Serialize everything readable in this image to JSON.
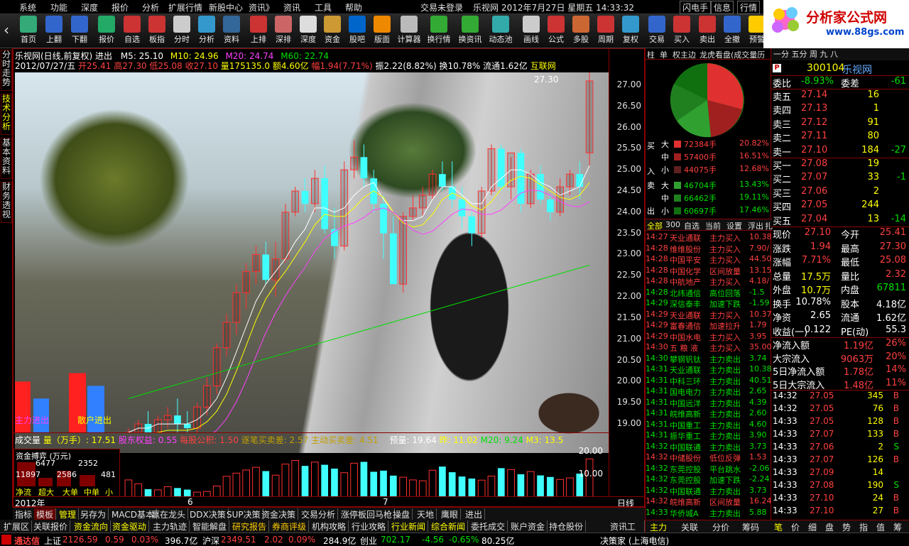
{
  "menu": {
    "items": [
      "系统",
      "功能",
      "深度",
      "报价",
      "分析",
      "扩展行情",
      "新股中心",
      "资讯》",
      "资讯",
      "工具",
      "帮助"
    ],
    "status": "交易未登录",
    "brand": "乐视网",
    "datetime": "2012年7月27日 星期五 14:33:32",
    "right_buttons": [
      "闪电手",
      "信息",
      "行情"
    ]
  },
  "toolbar": {
    "buttons": [
      "首页",
      "上翻",
      "下翻",
      "报价",
      "自选",
      "板指",
      "分时",
      "分析",
      "资料",
      "上排",
      "深排",
      "深度",
      "资金",
      "股吧",
      "版面",
      "计算器",
      "换行情",
      "换资讯",
      "动态池",
      "画线",
      "公式",
      "多股",
      "周期",
      "复权",
      "交易",
      "买入",
      "卖出",
      "全撤",
      "预警"
    ],
    "f6": "F6",
    "f9": "F9",
    "l2": "L2"
  },
  "logo": {
    "title": "分析家公式网",
    "url": "www.88gs.com"
  },
  "sidetabs": [
    "分时走势",
    "技术分析",
    "基本资料",
    "财务透视"
  ],
  "chart": {
    "header": "乐视网(日线,前复权) 进出",
    "ma5": "M5: 25.10",
    "ma10": "M10: 24.96",
    "ma20": "M20: 24.74",
    "ma60": "M60: 22.74",
    "info_date": "2012/07/27/五",
    "open": "开25.41",
    "high": "高27.30",
    "low": "低25.08",
    "close": "收27.10",
    "vol": "量175135.0",
    "amt": "额4.60亿",
    "chg": "幅1.94(7.71%)",
    "amp": "振2.22(8.82%)",
    "turn": "换10.78%",
    "float": "流通1.62亿",
    "sector": "互联网",
    "peak_label": "27.30",
    "sell_label": "散户进出",
    "buy_label": "主力进出",
    "axis": [
      "27.00",
      "26.50",
      "26.00",
      "25.50",
      "25.00",
      "24.50",
      "24.00",
      "23.50",
      "23.00",
      "22.50",
      "22.00",
      "21.50",
      "21.00",
      "20.50",
      "20.00",
      "19.50",
      "19.00"
    ],
    "vol_axis": [
      "20.00",
      "10.00"
    ],
    "vol_info": {
      "label": "成交量",
      "vol": "量（万手）: 17.51",
      "gdqy": "股东权益: 0.55",
      "mggj": "每股公积: 1.50",
      "zbmc": "逐笔买卖差: 2.57",
      "zdmc": "主动买卖差: 4.51",
      "yl": "预量: 19.64",
      "zuo": "昨: 11.02",
      "m20": "M20: 9.24",
      "m3": "M3: 13.5"
    },
    "fund": {
      "title": "资金搏弈 (万元)",
      "v1": "6477",
      "v2": "2352",
      "v3": "11897",
      "v4": "2586",
      "v5": "481",
      "labels": [
        "净流",
        "超大",
        "大单",
        "中单",
        "小单"
      ]
    },
    "year": "2012年",
    "month6": "6",
    "month7": "7",
    "period": "日线"
  },
  "bottom_tabs": [
    "指标",
    "模板",
    "管理",
    "另存为",
    "MACD基本",
    "赢在龙头",
    "DDX决策",
    "SUP决策",
    "资金决策",
    "交易分析",
    "涨停板回马枪",
    "操盘",
    "天地",
    "鹰眼",
    "进出"
  ],
  "bottom_tabs2": [
    "扩展区",
    "关联报价",
    "资金流向",
    "资金驱动",
    "主力轨迹",
    "智能解盘",
    "研究报告",
    "券商评级",
    "机构攻略",
    "行业攻略",
    "行业新闻",
    "综合新闻",
    "委托成交",
    "账户资金",
    "持仓股份",
    "资讯工场"
  ],
  "status": {
    "brand": "通达信",
    "sh_label": "上证",
    "sh": "2126.59",
    "sh_chg": "0.59",
    "sh_pct": "0.03%",
    "sh_amt": "396.7亿",
    "sz_label": "沪深",
    "sz": "2349.51",
    "sz_chg": "2.02",
    "sz_pct": "0.09%",
    "sz_amt": "284.9亿",
    "cy_label": "创业",
    "cy": "702.17",
    "cy_chg": "-4.56",
    "cy_pct": "-0.65%",
    "cy_amt": "80.25亿",
    "right": "决策家 (上海电信)"
  },
  "mid": {
    "tabs": [
      "柱",
      "单",
      "权主边",
      "龙虎看盘(成交量历"
    ],
    "buy": [
      {
        "size": "大",
        "v": "72384手",
        "p": "20.82%"
      },
      {
        "size": "中",
        "v": "57400手",
        "p": "16.51%"
      },
      {
        "size": "小",
        "v": "44075手",
        "p": "12.68%"
      }
    ],
    "sell": [
      {
        "size": "大",
        "v": "46704手",
        "p": "13.43%"
      },
      {
        "size": "中",
        "v": "66462手",
        "p": "19.11%"
      },
      {
        "size": "小",
        "v": "60697手",
        "p": "17.46%"
      }
    ],
    "side_labels": [
      "买",
      "入",
      "卖",
      "出"
    ],
    "filter_tabs": [
      "全部",
      "300",
      "自选",
      "当前",
      "设置",
      "浮出",
      "扎"
    ],
    "tickers": [
      [
        "14:27",
        "天业通联",
        "主力买入",
        "10.38"
      ],
      [
        "14:28",
        "维维股份",
        "主力买入",
        "7.90/"
      ],
      [
        "14:28",
        "中国平安",
        "主力买入",
        "44.50"
      ],
      [
        "14:28",
        "中国化学",
        "区间放量",
        "13.15"
      ],
      [
        "14:28",
        "中航地产",
        "主力买入",
        "4.18/"
      ],
      [
        "14:28",
        "北纬通信",
        "高位回落",
        "-1.5"
      ],
      [
        "14:29",
        "深信泰丰",
        "加速下跌",
        "-1.59"
      ],
      [
        "14:29",
        "天业通联",
        "主力买入",
        "10.37"
      ],
      [
        "14:29",
        "富春通信",
        "加速拉升",
        "1.79"
      ],
      [
        "14:29",
        "中国水电",
        "主力买入",
        "3.95"
      ],
      [
        "14:30",
        "五 粮 液",
        "主力买入",
        "35.00"
      ],
      [
        "14:30",
        "攀钢钒钛",
        "主力卖出",
        "3.74"
      ],
      [
        "14:31",
        "天业通联",
        "主力卖出",
        "10.38"
      ],
      [
        "14:31",
        "中科三环",
        "主力卖出",
        "40.51"
      ],
      [
        "14:31",
        "国电电力",
        "主力卖出",
        "2.65"
      ],
      [
        "14:31",
        "中国远洋",
        "主力卖出",
        "4.39"
      ],
      [
        "14:31",
        "皖维高新",
        "主力卖出",
        "2.60"
      ],
      [
        "14:31",
        "中国重工",
        "主力卖出",
        "4.60"
      ],
      [
        "14:31",
        "振华重工",
        "主力卖出",
        "3.90"
      ],
      [
        "14:32",
        "中国联通",
        "主力卖出",
        "3.73"
      ],
      [
        "14:32",
        "中储股份",
        "低位反弹",
        "1.53"
      ],
      [
        "14:32",
        "东莞控股",
        "平台跳水",
        "-2.06"
      ],
      [
        "14:32",
        "东莞控股",
        "加速下跌",
        "-2.24"
      ],
      [
        "14:32",
        "中国联通",
        "主力卖出",
        "3.73"
      ],
      [
        "14:32",
        "皖维高新",
        "区间放量",
        "16.24"
      ],
      [
        "14:33",
        "华侨城A",
        "主力卖出",
        "5.88"
      ]
    ],
    "bottom_tabs": [
      "主力",
      "关联",
      "分价",
      "筹码"
    ]
  },
  "right": {
    "header": "一分 五分 周 九 八",
    "code": "300104",
    "name": "乐视网",
    "wb_label": "委比",
    "wb": "-8.93%",
    "wc_label": "委差",
    "wc": "-61",
    "asks": [
      [
        "卖五",
        "27.14",
        "16",
        ""
      ],
      [
        "卖四",
        "27.13",
        "1",
        ""
      ],
      [
        "卖三",
        "27.12",
        "91",
        ""
      ],
      [
        "卖二",
        "27.11",
        "80",
        ""
      ],
      [
        "卖一",
        "27.10",
        "184",
        "-27"
      ]
    ],
    "bids": [
      [
        "买一",
        "27.08",
        "19",
        ""
      ],
      [
        "买二",
        "27.07",
        "33",
        "-1"
      ],
      [
        "买三",
        "27.06",
        "2",
        ""
      ],
      [
        "买四",
        "27.05",
        "244",
        ""
      ],
      [
        "买五",
        "27.04",
        "13",
        "-14"
      ]
    ],
    "stats": [
      [
        "现价",
        "27.10",
        "今开",
        "25.41"
      ],
      [
        "涨跌",
        "1.94",
        "最高",
        "27.30"
      ],
      [
        "涨幅",
        "7.71%",
        "最低",
        "25.08"
      ],
      [
        "总量",
        "17.5万",
        "量比",
        "2.32"
      ],
      [
        "外盘",
        "10.7万",
        "内盘",
        "67811"
      ],
      [
        "换手",
        "10.78%",
        "股本",
        "4.18亿"
      ],
      [
        "净资",
        "2.65",
        "流通",
        "1.62亿"
      ],
      [
        "收益(一)",
        "0.122",
        "PE(动)",
        "55.3"
      ]
    ],
    "flows": [
      [
        "净流入额",
        "1.19亿",
        "26%"
      ],
      [
        "大宗流入",
        "9063万",
        "20%"
      ],
      [
        "5日净流入额",
        "1.78亿",
        "14%"
      ],
      [
        "5日大宗流入",
        "1.48亿",
        "11%"
      ]
    ],
    "trades": [
      [
        "14:32",
        "27.05",
        "345",
        "B"
      ],
      [
        "14:32",
        "27.05",
        "76",
        "B"
      ],
      [
        "14:33",
        "27.05",
        "128",
        "B"
      ],
      [
        "14:33",
        "27.07",
        "133",
        "B"
      ],
      [
        "14:33",
        "27.06",
        "2",
        "S"
      ],
      [
        "14:33",
        "27.07",
        "126",
        "B"
      ],
      [
        "14:33",
        "27.09",
        "14",
        ""
      ],
      [
        "14:33",
        "27.08",
        "190",
        "S"
      ],
      [
        "14:33",
        "27.10",
        "24",
        "B"
      ],
      [
        "14:33",
        "27.10",
        "27",
        "B"
      ]
    ],
    "bottom_tabs": [
      "笔",
      "价",
      "细",
      "盘",
      "势",
      "指",
      "值",
      "筹"
    ]
  },
  "chart_data": {
    "type": "candlestick",
    "title": "乐视网(日线,前复权)",
    "ylim": [
      18.8,
      27.3
    ],
    "ylabel": "",
    "candles": [
      [
        18.6,
        18.9,
        18.3,
        18.8
      ],
      [
        18.8,
        19.1,
        18.5,
        19.0
      ],
      [
        19.0,
        19.3,
        18.6,
        18.8
      ],
      [
        18.8,
        19.2,
        18.5,
        19.1
      ],
      [
        19.1,
        19.4,
        18.9,
        19.2
      ],
      [
        19.2,
        19.6,
        18.7,
        19.0
      ],
      [
        19.0,
        19.3,
        18.6,
        18.9
      ],
      [
        18.9,
        19.5,
        18.7,
        19.4
      ],
      [
        19.4,
        20.1,
        19.2,
        19.9
      ],
      [
        19.9,
        20.9,
        19.7,
        20.8
      ],
      [
        20.8,
        21.6,
        20.6,
        21.4
      ],
      [
        21.4,
        22.3,
        21.1,
        22.1
      ],
      [
        22.1,
        22.8,
        21.7,
        22.6
      ],
      [
        22.6,
        23.2,
        22.3,
        23.0
      ],
      [
        23.0,
        23.3,
        22.3,
        22.4
      ],
      [
        22.4,
        23.3,
        22.0,
        22.9
      ],
      [
        22.9,
        24.2,
        22.8,
        24.0
      ],
      [
        24.0,
        24.6,
        23.9,
        24.5
      ],
      [
        24.5,
        24.8,
        24.0,
        24.2
      ],
      [
        24.2,
        25.0,
        24.0,
        24.8
      ],
      [
        24.8,
        25.1,
        23.5,
        23.6
      ],
      [
        23.6,
        24.1,
        22.9,
        23.2
      ],
      [
        23.2,
        25.2,
        23.1,
        25.0
      ],
      [
        25.0,
        25.7,
        24.8,
        25.3
      ],
      [
        25.3,
        25.6,
        24.6,
        24.8
      ],
      [
        24.8,
        25.0,
        24.0,
        24.2
      ],
      [
        24.2,
        24.4,
        22.9,
        23.5
      ],
      [
        23.5,
        23.9,
        22.5,
        22.3
      ],
      [
        22.3,
        24.0,
        22.1,
        23.9
      ],
      [
        23.9,
        24.4,
        23.8,
        24.1
      ],
      [
        24.1,
        24.6,
        23.9,
        24.4
      ],
      [
        24.4,
        25.0,
        24.3,
        24.9
      ],
      [
        24.9,
        25.2,
        24.5,
        24.6
      ],
      [
        24.6,
        25.2,
        24.1,
        24.3
      ],
      [
        24.3,
        24.6,
        23.6,
        23.9
      ],
      [
        23.9,
        24.0,
        23.2,
        23.5
      ],
      [
        23.5,
        24.6,
        23.4,
        24.5
      ],
      [
        24.5,
        25.6,
        24.4,
        25.5
      ],
      [
        25.5,
        25.6,
        24.5,
        24.6
      ],
      [
        24.6,
        25.3,
        24.3,
        25.4
      ],
      [
        25.4,
        25.5,
        24.0,
        24.2
      ],
      [
        24.2,
        25.0,
        24.1,
        24.9
      ],
      [
        24.9,
        25.1,
        24.2,
        24.3
      ],
      [
        24.3,
        24.4,
        23.8,
        24.0
      ],
      [
        24.0,
        24.8,
        23.9,
        24.6
      ],
      [
        24.6,
        25.0,
        24.4,
        24.9
      ],
      [
        24.9,
        25.2,
        24.3,
        24.6
      ],
      [
        25.4,
        27.3,
        25.1,
        27.1
      ]
    ],
    "ma5": [
      18.8,
      18.9,
      18.9,
      19.0,
      19.0,
      19.0,
      19.0,
      19.1,
      19.3,
      19.6,
      20.1,
      20.7,
      21.3,
      21.9,
      22.3,
      22.6,
      22.9,
      23.3,
      23.6,
      24.1,
      24.1,
      24.0,
      24.1,
      24.4,
      24.6,
      24.7,
      24.3,
      24.0,
      23.8,
      23.8,
      23.9,
      24.3,
      24.6,
      24.6,
      24.4,
      24.2,
      24.2,
      24.6,
      24.8,
      25.0,
      25.0,
      24.9,
      24.7,
      24.6,
      24.4,
      24.5,
      24.6,
      25.1
    ],
    "vol": [
      8.2,
      6.5,
      4.1,
      3.8,
      5.2,
      4.6,
      3.9,
      2.8,
      3.1,
      5.5,
      9.8,
      11.2,
      12.6,
      13.8,
      12.1,
      10.3,
      15.2,
      16.8,
      14.4,
      16.1,
      14.9,
      13.2,
      11.4,
      15.6,
      16.2,
      11.8,
      12.3,
      10.1,
      9.4,
      8.2,
      7.8,
      12.5,
      14.1,
      11.6,
      9.7,
      8.8,
      8.1,
      9.9,
      13.4,
      12.8,
      10.7,
      11.9,
      10.2,
      9.5,
      8.4,
      9.1,
      11.0,
      17.5
    ]
  }
}
